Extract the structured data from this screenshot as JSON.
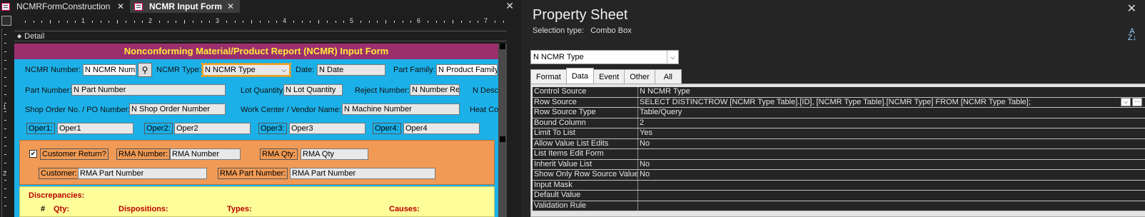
{
  "tabs": [
    {
      "label": "NCMRFormConstruction",
      "active": false
    },
    {
      "label": "NCMR Input Form",
      "active": true
    }
  ],
  "ruler": {
    "numbers": [
      "1",
      "2",
      "3",
      "4",
      "5",
      "6",
      "7"
    ],
    "v_numbers": [
      "1",
      "2"
    ]
  },
  "section": {
    "label": "Detail"
  },
  "form": {
    "title": "Nonconforming Material/Product Report (NCMR) Input Form",
    "ncmr_number_label": "NCMR Number:",
    "ncmr_number_value": "N NCMR Numb",
    "ncmr_type_label": "NCMR Type:",
    "ncmr_type_value": "N NCMR Type",
    "date_label": "Date:",
    "date_value": "N Date",
    "part_family_label": "Part Family:",
    "part_family_value": "N Product Family",
    "part_number_label": "Part Number:",
    "part_number_value": "N Part Number",
    "lot_qty_label": "Lot Quantity:",
    "lot_qty_value": "N Lot Quantity",
    "reject_number_label": "Reject Number:",
    "reject_number_value": "N Number Rej",
    "desc_partial": "N Desc",
    "shop_order_label": "Shop Order No. / PO Number:",
    "shop_order_value": "N Shop Order Number",
    "work_center_label": "Work Center / Vendor Name:",
    "work_center_value": "N Machine Number",
    "heat_partial": "Heat Co",
    "oper1_label": "Oper1:",
    "oper1_value": "Oper1",
    "oper2_label": "Oper2:",
    "oper2_value": "Oper2",
    "oper3_label": "Oper3:",
    "oper3_value": "Oper3",
    "oper4_label": "Oper4:",
    "oper4_value": "Oper4",
    "customer_return_label": "Customer Return?",
    "customer_return_checked": true,
    "check_glyph": "✔",
    "rma_number_label": "RMA Number:",
    "rma_number_value": "RMA Number",
    "rma_qty_label": "RMA Qty:",
    "rma_qty_value": "RMA Qty",
    "customer_label": "Customer:",
    "customer_value": "RMA Part Number",
    "rma_part_label": "RMA Part Number:",
    "rma_part_value": "RMA Part Number",
    "discrepancies_label": "Discrepancies:",
    "disc_cols": [
      "#",
      "Qty:",
      "Dispositions:",
      "Types:",
      "Causes:"
    ]
  },
  "property_sheet": {
    "title": "Property Sheet",
    "selection_type_label": "Selection type:",
    "selection_type_value": "Combo Box",
    "selected_object": "N NCMR Type",
    "tabs": [
      "Format",
      "Data",
      "Event",
      "Other",
      "All"
    ],
    "active_tab": "Data",
    "rows": [
      {
        "name": "Control Source",
        "value": "N NCMR Type"
      },
      {
        "name": "Row Source",
        "value": "SELECT DISTINCTROW [NCMR Type Table].[ID], [NCMR Type Table].[NCMR Type] FROM [NCMR Type Table];"
      },
      {
        "name": "Row Source Type",
        "value": "Table/Query"
      },
      {
        "name": "Bound Column",
        "value": "2"
      },
      {
        "name": "Limit To List",
        "value": "Yes"
      },
      {
        "name": "Allow Value List Edits",
        "value": "No"
      },
      {
        "name": "List Items Edit Form",
        "value": ""
      },
      {
        "name": "Inherit Value List",
        "value": "No"
      },
      {
        "name": "Show Only Row Source Values",
        "value": "No"
      },
      {
        "name": "Input Mask",
        "value": ""
      },
      {
        "name": "Default Value",
        "value": ""
      },
      {
        "name": "Validation Rule",
        "value": ""
      }
    ]
  },
  "colors": {
    "form_bg": "#1cb0e8",
    "title_bar": "#9b2f6e",
    "title_text": "#ffeb3b",
    "customer_panel": "#f09a55",
    "discrepancy_panel": "#fdfd9a",
    "selection_outline": "#f0a020"
  }
}
